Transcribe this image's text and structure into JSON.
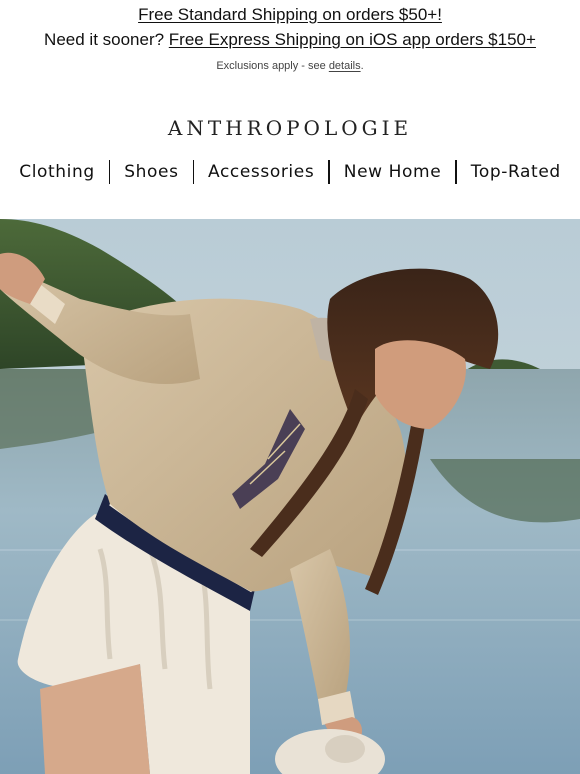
{
  "promo": {
    "line1_link": "Free Standard Shipping on orders $50+!",
    "line2_prefix": "Need it sooner? ",
    "line2_link": "Free Express Shipping on iOS app orders $150+",
    "exclusions_prefix": "Exclusions apply - see ",
    "exclusions_link": "details",
    "exclusions_suffix": "."
  },
  "brand": {
    "logo": "ANTHROPOLOGIE"
  },
  "nav": {
    "items": [
      "Clothing",
      "Shoes",
      "Accessories",
      "New Home",
      "Top-Rated"
    ]
  },
  "hero": {
    "icon": "hero-photo"
  }
}
